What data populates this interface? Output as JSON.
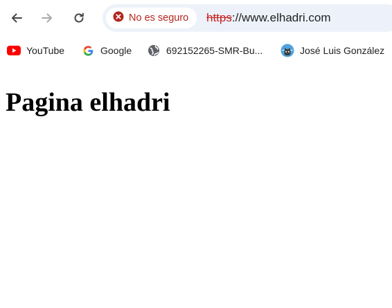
{
  "address_bar": {
    "security_label": "No es seguro",
    "url_scheme": "https",
    "url_rest": "://www.elhadri.com"
  },
  "bookmarks": [
    {
      "label": "YouTube",
      "icon": "youtube-icon"
    },
    {
      "label": "Google",
      "icon": "google-icon"
    },
    {
      "label": "692152265-SMR-Bu...",
      "icon": "globe-icon"
    },
    {
      "label": "José Luis González",
      "icon": "avatar-icon"
    }
  ],
  "page": {
    "heading": "Pagina elhadri"
  },
  "colors": {
    "omnibox_bg": "#edf2fa",
    "not_secure_red": "#b3261e",
    "youtube_red": "#ff0000"
  }
}
